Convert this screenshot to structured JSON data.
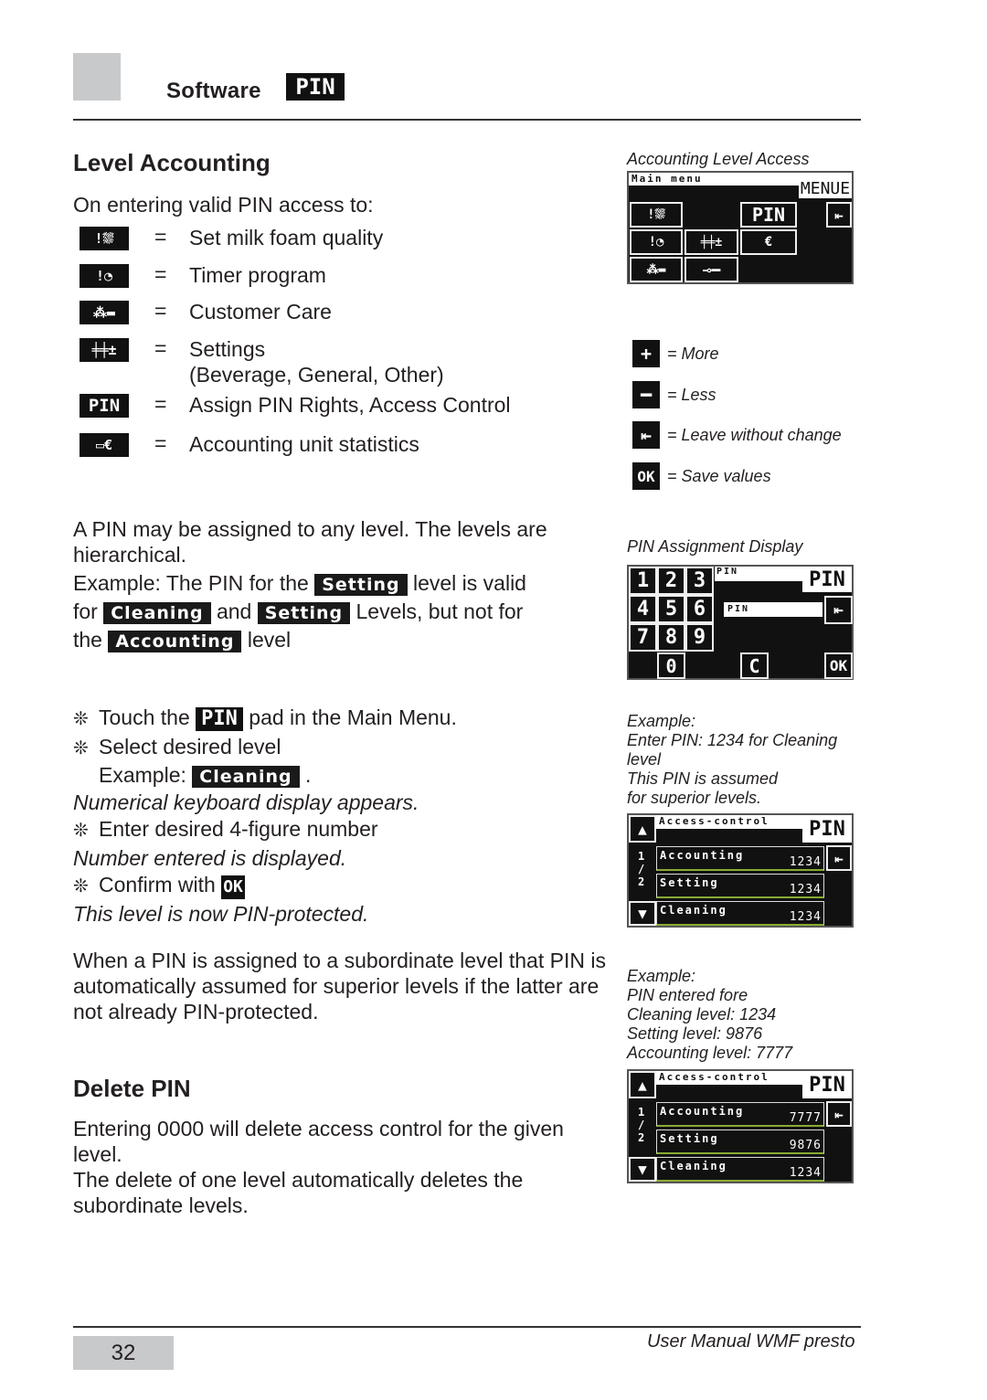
{
  "header": {
    "section": "Software",
    "badge": "PIN"
  },
  "left": {
    "heading": "Level Accounting",
    "intro": "On entering valid PIN access to:",
    "icon_list": [
      {
        "icon": "milk-foam-icon",
        "glyph": "!⛆",
        "eq": "=",
        "text": "Set milk foam quality"
      },
      {
        "icon": "timer-icon",
        "glyph": "!◔",
        "eq": "=",
        "text": "Timer program"
      },
      {
        "icon": "customer-care-icon",
        "glyph": "⁂▬",
        "eq": "=",
        "text": "Customer Care"
      },
      {
        "icon": "settings-icon",
        "glyph": "╪╪±",
        "eq": "=",
        "text": "Settings",
        "sub": "(Beverage, General, Other)"
      },
      {
        "icon": "pin-icon",
        "glyph": "PIN",
        "eq": "=",
        "text": "Assign PIN Rights, Access Control"
      },
      {
        "icon": "accounting-icon",
        "glyph": "▭€",
        "eq": "=",
        "text": "Accounting unit statistics"
      }
    ],
    "para1_line1": "A PIN may be assigned to any level. The levels are",
    "para1_line2": "hierarchical.",
    "ex_a": "Example: The PIN for the",
    "ex_setting": "Setting",
    "ex_b": "level is valid",
    "ex_for": "for",
    "ex_cleaning": "Cleaning",
    "ex_and": "and",
    "ex_setting2": "Setting",
    "ex_c": "Levels, but not for",
    "ex_the": "the",
    "ex_accounting": "Accounting",
    "ex_level": "level",
    "steps": {
      "bullet": "❊",
      "s1a": "Touch the",
      "s1_badge": "PIN",
      "s1b": "pad in the Main Menu.",
      "s2": "Select desired level",
      "s2_ex": "Example:",
      "s2_badge": "Cleaning",
      "s2_dot": ".",
      "r1": "Numerical keyboard display appears.",
      "s3": "Enter desired 4-figure number",
      "r2": "Number entered is displayed.",
      "s4": "Confirm with",
      "s4_badge": "OK",
      "r3": "This level is now PIN-protected."
    },
    "para2_line1": "When a PIN is assigned to a subordinate level that PIN is",
    "para2_line2": "automatically assumed for superior levels if the latter are",
    "para2_line3": "not already PIN-protected.",
    "delete_heading": "Delete PIN",
    "del_line1": "Entering 0000 will delete access control for the given",
    "del_line2": "level.",
    "del_line3": "The delete of one level automatically deletes the",
    "del_line4": "subordinate levels."
  },
  "right": {
    "cap_main": "Accounting Level Access",
    "main_menu": {
      "title": "Main menu",
      "tab": "MENUE",
      "pin": "PIN",
      "euro": "€"
    },
    "legend": [
      {
        "icon": "plus-icon",
        "glyph": "+",
        "text": "= More"
      },
      {
        "icon": "minus-icon",
        "glyph": "━",
        "text": "= Less"
      },
      {
        "icon": "leave-icon",
        "glyph": "⇤",
        "text": "= Leave without change"
      },
      {
        "icon": "ok-icon",
        "glyph": "OK",
        "text": "= Save values"
      }
    ],
    "cap_pin": "PIN Assignment Display",
    "keypad": {
      "keys": [
        "1",
        "2",
        "3",
        "4",
        "5",
        "6",
        "7",
        "8",
        "9"
      ],
      "zero": "0",
      "clear": "C",
      "ok": "OK",
      "small_title": "PIN",
      "tab": "PIN",
      "field": "PIN"
    },
    "example1": [
      "Example:",
      "Enter PIN: 1234 for Cleaning",
      "level",
      "This PIN  is assumed",
      "for superior levels."
    ],
    "access1": {
      "title": "Access-control",
      "tab": "PIN",
      "page_top": "1",
      "page_sep": "/",
      "page_bot": "2",
      "rows": [
        {
          "name": "Accounting",
          "value": "1234"
        },
        {
          "name": "Setting",
          "value": "1234"
        },
        {
          "name": "Cleaning",
          "value": "1234"
        }
      ]
    },
    "example2": [
      "Example:",
      "PIN  entered fore",
      "Cleaning level: 1234",
      "Setting level: 9876",
      "Accounting level: 7777"
    ],
    "access2": {
      "title": "Access-control",
      "tab": "PIN",
      "page_top": "1",
      "page_sep": "/",
      "page_bot": "2",
      "rows": [
        {
          "name": "Accounting",
          "value": "7777"
        },
        {
          "name": "Setting",
          "value": "9876"
        },
        {
          "name": "Cleaning",
          "value": "1234"
        }
      ]
    }
  },
  "footer": {
    "page_number": "32",
    "title": "User Manual WMF presto"
  }
}
